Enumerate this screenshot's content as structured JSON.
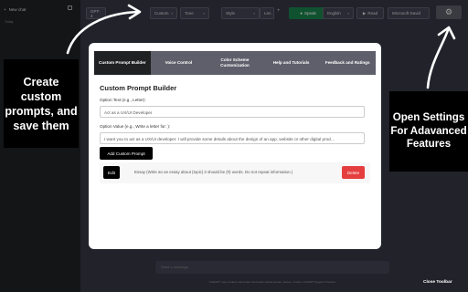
{
  "sidebar": {
    "new_chat": "New chat",
    "today": "Today"
  },
  "toolbar": {
    "model": "GPT-4",
    "custom": "Custom",
    "tone": "Tone",
    "style": "Style",
    "length": "Len",
    "speak": "Speak",
    "language": "English",
    "read": "Read",
    "voice": "Microsoft David"
  },
  "composer": {
    "placeholder": "Send a message",
    "footnote": "ChatGPT may produce inaccurate information about people, places, or facts. ChatGPT August 3 Version"
  },
  "close_toolbar": "Close Toolbar",
  "callouts": {
    "left": "Create custom prompts, and save them",
    "right": "Open Settings For Adavanced Features"
  },
  "modal": {
    "tabs": [
      "Custom Prompt Builder",
      "Voice Control",
      "Color Scheme Customization",
      "Help and Tutorials",
      "Feedback and Ratings"
    ],
    "active_tab": 0,
    "title": "Custom Prompt Builder",
    "option_text_label": "Option Text (e.g., Letter):",
    "option_text_value": "Act as a UX/UI Developer",
    "option_value_label": "Option Value (e.g., Write a letter for: ):",
    "option_value_value": "I want you to act as a UX/UI developer. I will provide some details about the design of an app, website or other digital prod…",
    "add_button": "Add Custom Prompt",
    "saved_prompts": [
      {
        "edit": "Edit",
        "text": "Essay (Write an an essay about {topic} it should be {#} words. Do not repeat information.)",
        "delete": "Delete"
      }
    ]
  },
  "colors": {
    "accent_green": "#1a7f4b",
    "delete_red": "#e53e3e",
    "tab_active": "#202123",
    "tab_bg": "#5f5f6b"
  }
}
